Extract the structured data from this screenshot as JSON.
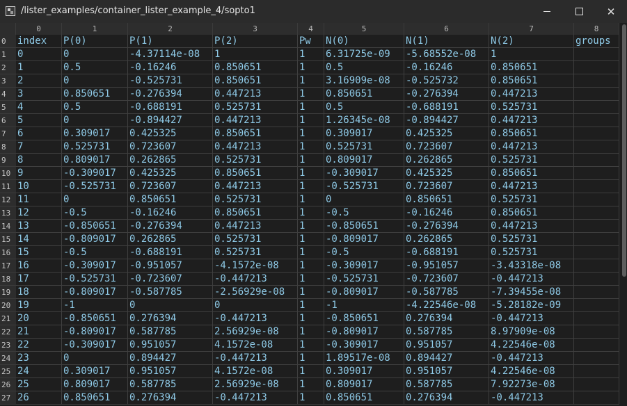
{
  "window": {
    "title": "/lister_examples/container_lister_example_4/sopto1"
  },
  "columns": [
    "0",
    "1",
    "2",
    "3",
    "4",
    "5",
    "6",
    "7",
    "8"
  ],
  "rows": [
    {
      "label": "0",
      "cells": [
        "index",
        "P(0)",
        "P(1)",
        "P(2)",
        "Pw",
        "N(0)",
        "N(1)",
        "N(2)",
        "groups"
      ]
    },
    {
      "label": "1",
      "cells": [
        "0",
        "0",
        "-4.37114e-08",
        "1",
        "1",
        "6.31725e-09",
        "-5.68552e-08",
        "1",
        ""
      ]
    },
    {
      "label": "2",
      "cells": [
        "1",
        "0.5",
        "-0.16246",
        "0.850651",
        "1",
        "0.5",
        "-0.16246",
        "0.850651",
        ""
      ]
    },
    {
      "label": "3",
      "cells": [
        "2",
        "0",
        "-0.525731",
        "0.850651",
        "1",
        "3.16909e-08",
        "-0.525732",
        "0.850651",
        ""
      ]
    },
    {
      "label": "4",
      "cells": [
        "3",
        "0.850651",
        "-0.276394",
        "0.447213",
        "1",
        "0.850651",
        "-0.276394",
        "0.447213",
        ""
      ]
    },
    {
      "label": "5",
      "cells": [
        "4",
        "0.5",
        "-0.688191",
        "0.525731",
        "1",
        "0.5",
        "-0.688191",
        "0.525731",
        ""
      ]
    },
    {
      "label": "6",
      "cells": [
        "5",
        "0",
        "-0.894427",
        "0.447213",
        "1",
        "1.26345e-08",
        "-0.894427",
        "0.447213",
        ""
      ]
    },
    {
      "label": "7",
      "cells": [
        "6",
        "0.309017",
        "0.425325",
        "0.850651",
        "1",
        "0.309017",
        "0.425325",
        "0.850651",
        ""
      ]
    },
    {
      "label": "8",
      "cells": [
        "7",
        "0.525731",
        "0.723607",
        "0.447213",
        "1",
        "0.525731",
        "0.723607",
        "0.447213",
        ""
      ]
    },
    {
      "label": "9",
      "cells": [
        "8",
        "0.809017",
        "0.262865",
        "0.525731",
        "1",
        "0.809017",
        "0.262865",
        "0.525731",
        ""
      ]
    },
    {
      "label": "10",
      "cells": [
        "9",
        "-0.309017",
        "0.425325",
        "0.850651",
        "1",
        "-0.309017",
        "0.425325",
        "0.850651",
        ""
      ]
    },
    {
      "label": "11",
      "cells": [
        "10",
        "-0.525731",
        "0.723607",
        "0.447213",
        "1",
        "-0.525731",
        "0.723607",
        "0.447213",
        ""
      ]
    },
    {
      "label": "12",
      "cells": [
        "11",
        "0",
        "0.850651",
        "0.525731",
        "1",
        "0",
        "0.850651",
        "0.525731",
        ""
      ]
    },
    {
      "label": "13",
      "cells": [
        "12",
        "-0.5",
        "-0.16246",
        "0.850651",
        "1",
        "-0.5",
        "-0.16246",
        "0.850651",
        ""
      ]
    },
    {
      "label": "14",
      "cells": [
        "13",
        "-0.850651",
        "-0.276394",
        "0.447213",
        "1",
        "-0.850651",
        "-0.276394",
        "0.447213",
        ""
      ]
    },
    {
      "label": "15",
      "cells": [
        "14",
        "-0.809017",
        "0.262865",
        "0.525731",
        "1",
        "-0.809017",
        "0.262865",
        "0.525731",
        ""
      ]
    },
    {
      "label": "16",
      "cells": [
        "15",
        "-0.5",
        "-0.688191",
        "0.525731",
        "1",
        "-0.5",
        "-0.688191",
        "0.525731",
        ""
      ]
    },
    {
      "label": "17",
      "cells": [
        "16",
        "-0.309017",
        "-0.951057",
        "-4.1572e-08",
        "1",
        "-0.309017",
        "-0.951057",
        "-3.43318e-08",
        ""
      ]
    },
    {
      "label": "18",
      "cells": [
        "17",
        "-0.525731",
        "-0.723607",
        "-0.447213",
        "1",
        "-0.525731",
        "-0.723607",
        "-0.447213",
        ""
      ]
    },
    {
      "label": "19",
      "cells": [
        "18",
        "-0.809017",
        "-0.587785",
        "-2.56929e-08",
        "1",
        "-0.809017",
        "-0.587785",
        "-7.39455e-08",
        ""
      ]
    },
    {
      "label": "20",
      "cells": [
        "19",
        "-1",
        "0",
        "0",
        "1",
        "-1",
        "-4.22546e-08",
        "-5.28182e-09",
        ""
      ]
    },
    {
      "label": "21",
      "cells": [
        "20",
        "-0.850651",
        "0.276394",
        "-0.447213",
        "1",
        "-0.850651",
        "0.276394",
        "-0.447213",
        ""
      ]
    },
    {
      "label": "22",
      "cells": [
        "21",
        "-0.809017",
        "0.587785",
        "2.56929e-08",
        "1",
        "-0.809017",
        "0.587785",
        "8.97909e-08",
        ""
      ]
    },
    {
      "label": "23",
      "cells": [
        "22",
        "-0.309017",
        "0.951057",
        "4.1572e-08",
        "1",
        "-0.309017",
        "0.951057",
        "4.22546e-08",
        ""
      ]
    },
    {
      "label": "24",
      "cells": [
        "23",
        "0",
        "0.894427",
        "-0.447213",
        "1",
        "1.89517e-08",
        "0.894427",
        "-0.447213",
        ""
      ]
    },
    {
      "label": "25",
      "cells": [
        "24",
        "0.309017",
        "0.951057",
        "4.1572e-08",
        "1",
        "0.309017",
        "0.951057",
        "4.22546e-08",
        ""
      ]
    },
    {
      "label": "26",
      "cells": [
        "25",
        "0.809017",
        "0.587785",
        "2.56929e-08",
        "1",
        "0.809017",
        "0.587785",
        "7.92273e-08",
        ""
      ]
    },
    {
      "label": "27",
      "cells": [
        "26",
        "0.850651",
        "0.276394",
        "-0.447213",
        "1",
        "0.850651",
        "0.276394",
        "-0.447213",
        ""
      ]
    }
  ]
}
